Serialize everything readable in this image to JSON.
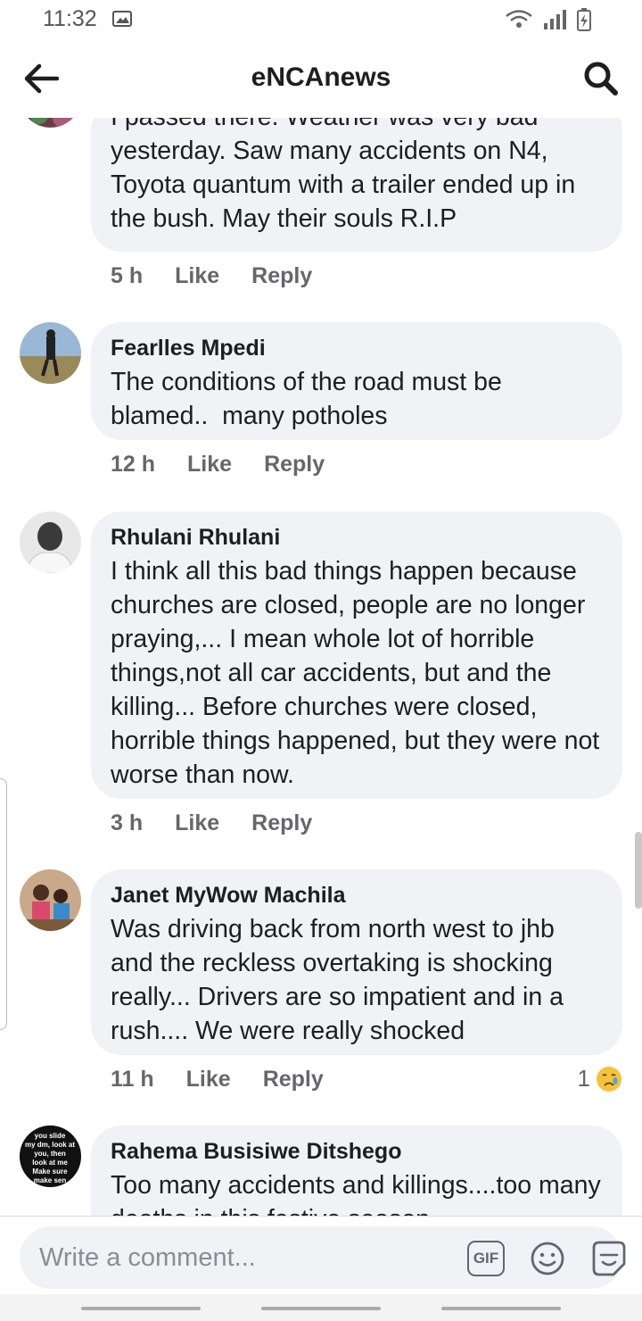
{
  "status": {
    "time": "11:32"
  },
  "header": {
    "title": "eNCAnews"
  },
  "comments": [
    {
      "author": "",
      "text": "I passed there. Weather was very bad yesterday. Saw many accidents on N4, Toyota quantum with a trailer ended up in the bush. May their souls R.I.P",
      "time": "5 h",
      "like": "Like",
      "reply": "Reply"
    },
    {
      "author": "Fearlles Mpedi",
      "text": "The conditions of the road must be blamed..  many potholes",
      "time": "12 h",
      "like": "Like",
      "reply": "Reply"
    },
    {
      "author": "Rhulani Rhulani",
      "text": "I think all this bad things happen because churches are closed, people are no longer praying,... I mean whole lot of horrible things,not all car accidents, but and the killing... Before churches were closed, horrible things happened, but they were not worse than now.",
      "time": "3 h",
      "like": "Like",
      "reply": "Reply"
    },
    {
      "author": "Janet MyWow Machila",
      "text": "Was driving back from north west to jhb and the reckless overtaking is shocking really... Drivers are so impatient and in a rush.... We were really shocked",
      "time": "11 h",
      "like": "Like",
      "reply": "Reply",
      "reaction_count": "1"
    },
    {
      "author": "Rahema Busisiwe Ditshego",
      "text": "Too many accidents and killings....too many deaths in this festive season",
      "avatar_text": "you slide my dm, look at you, then look at me Make sure make sen"
    }
  ],
  "composer": {
    "placeholder": "Write a comment...",
    "gif": "GIF"
  },
  "colors": {
    "bubble": "#f0f2f5",
    "meta": "#65676b",
    "text": "#1c1e21"
  }
}
